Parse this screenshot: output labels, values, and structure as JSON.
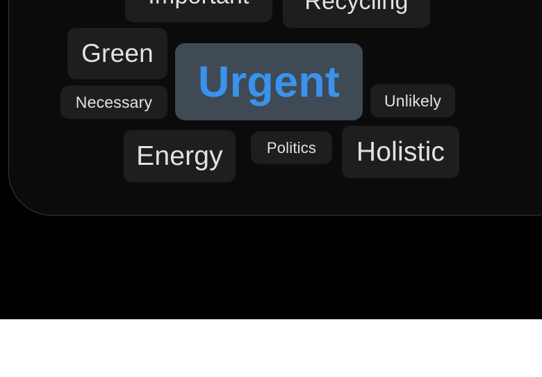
{
  "word_cloud": {
    "chips": [
      {
        "label": "Important",
        "selected": false
      },
      {
        "label": "Recycling",
        "selected": false
      },
      {
        "label": "Green",
        "selected": false
      },
      {
        "label": "Urgent",
        "selected": true
      },
      {
        "label": "Necessary",
        "selected": false
      },
      {
        "label": "Unlikely",
        "selected": false
      },
      {
        "label": "Energy",
        "selected": false
      },
      {
        "label": "Politics",
        "selected": false
      },
      {
        "label": "Holistic",
        "selected": false
      }
    ]
  },
  "colors": {
    "background": "#000000",
    "chip_background": "#1e1e1e",
    "chip_text": "#e2e2e2",
    "selected_chip_background": "#3f4a55",
    "selected_chip_text": "#3a92ec",
    "outer_background": "#ffffff"
  }
}
